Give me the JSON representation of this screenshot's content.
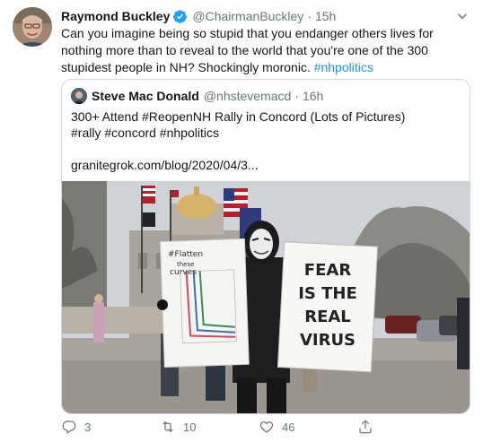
{
  "tweet": {
    "author_name": "Raymond Buckley",
    "handle": "@ChairmanBuckley",
    "separator": "·",
    "time": "15h",
    "text": "Can you imagine being so stupid that you endanger others lives for nothing more than to reveal to the world that you're one of the 300 stupidest people in NH? Shockingly moronic. ",
    "hashtag": "#nhpolitics",
    "icons": {
      "verified": "verified-badge-icon",
      "menu": "chevron-down-icon"
    },
    "colors": {
      "accent": "#1da1f2",
      "link": "#1b95e0",
      "muted": "#657786",
      "border": "#ccd6dd"
    }
  },
  "quote": {
    "author_name": "Steve Mac Donald",
    "handle": "@nhstevemacd",
    "separator": "·",
    "time": "16h",
    "line1": "300+ Attend #ReopenNH Rally in Concord (Lots of Pictures)",
    "line2": "#rally #concord #nhpolitics",
    "link": "granitegrok.com/blog/2020/04/3...",
    "photo": {
      "left_sign": [
        "#Flatten",
        "these",
        "curves"
      ],
      "right_sign": [
        "FEAR",
        "IS THE",
        "REAL",
        "VIRUS"
      ]
    }
  },
  "actions": {
    "reply_count": "3",
    "retweet_count": "10",
    "like_count": "46",
    "icons": [
      "reply-icon",
      "retweet-icon",
      "like-icon",
      "share-icon"
    ]
  }
}
